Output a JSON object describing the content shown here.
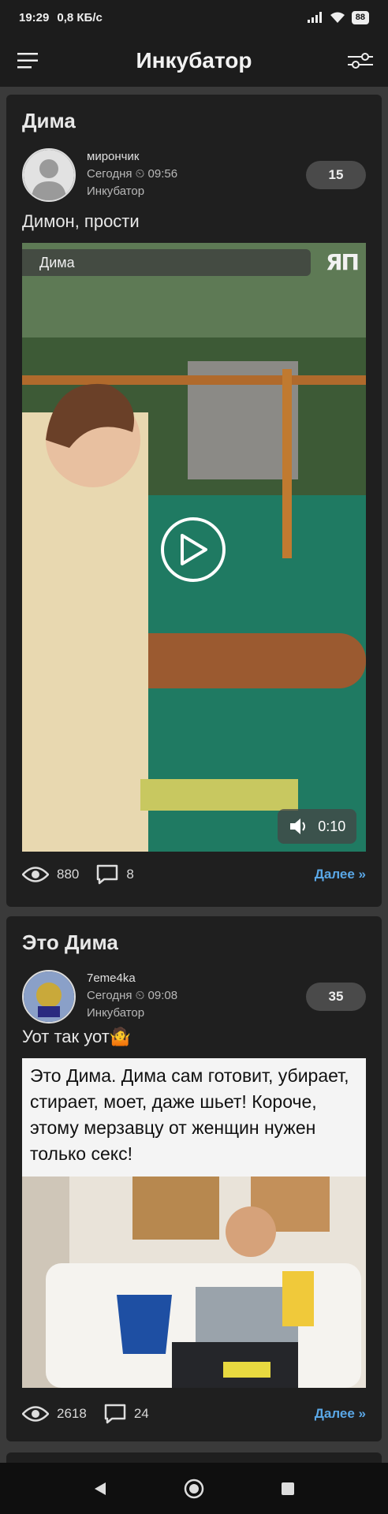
{
  "status_bar": {
    "time": "19:29",
    "speed": "0,8 КБ/с",
    "battery": "88"
  },
  "app_bar": {
    "title": "Инкубатор"
  },
  "posts": [
    {
      "title": "Дима",
      "author": "мирончик",
      "date": "Сегодня",
      "time": "09:56",
      "community": "Инкубатор",
      "rating": "15",
      "text": "Димон, прости",
      "media": {
        "type": "video",
        "label": "Дима",
        "logo": "ЯП",
        "duration": "0:10"
      },
      "views": "880",
      "comments": "8",
      "more": "Далее »"
    },
    {
      "title": "Это Дима",
      "author": "7eme4ka",
      "date": "Сегодня",
      "time": "09:08",
      "community": "Инкубатор",
      "rating": "35",
      "text": "Уот так уот🤷",
      "media": {
        "type": "image",
        "caption": "Это Дима. Дима сам готовит, убирает, стирает, моет, даже шьет! Короче, этому мерзавцу от женщин нужен только секс!"
      },
      "views": "2618",
      "comments": "24",
      "more": "Далее »"
    }
  ],
  "colors": {
    "accent": "#5aa7e6",
    "card": "#1f1f1f",
    "background": "#3a3a3a"
  }
}
